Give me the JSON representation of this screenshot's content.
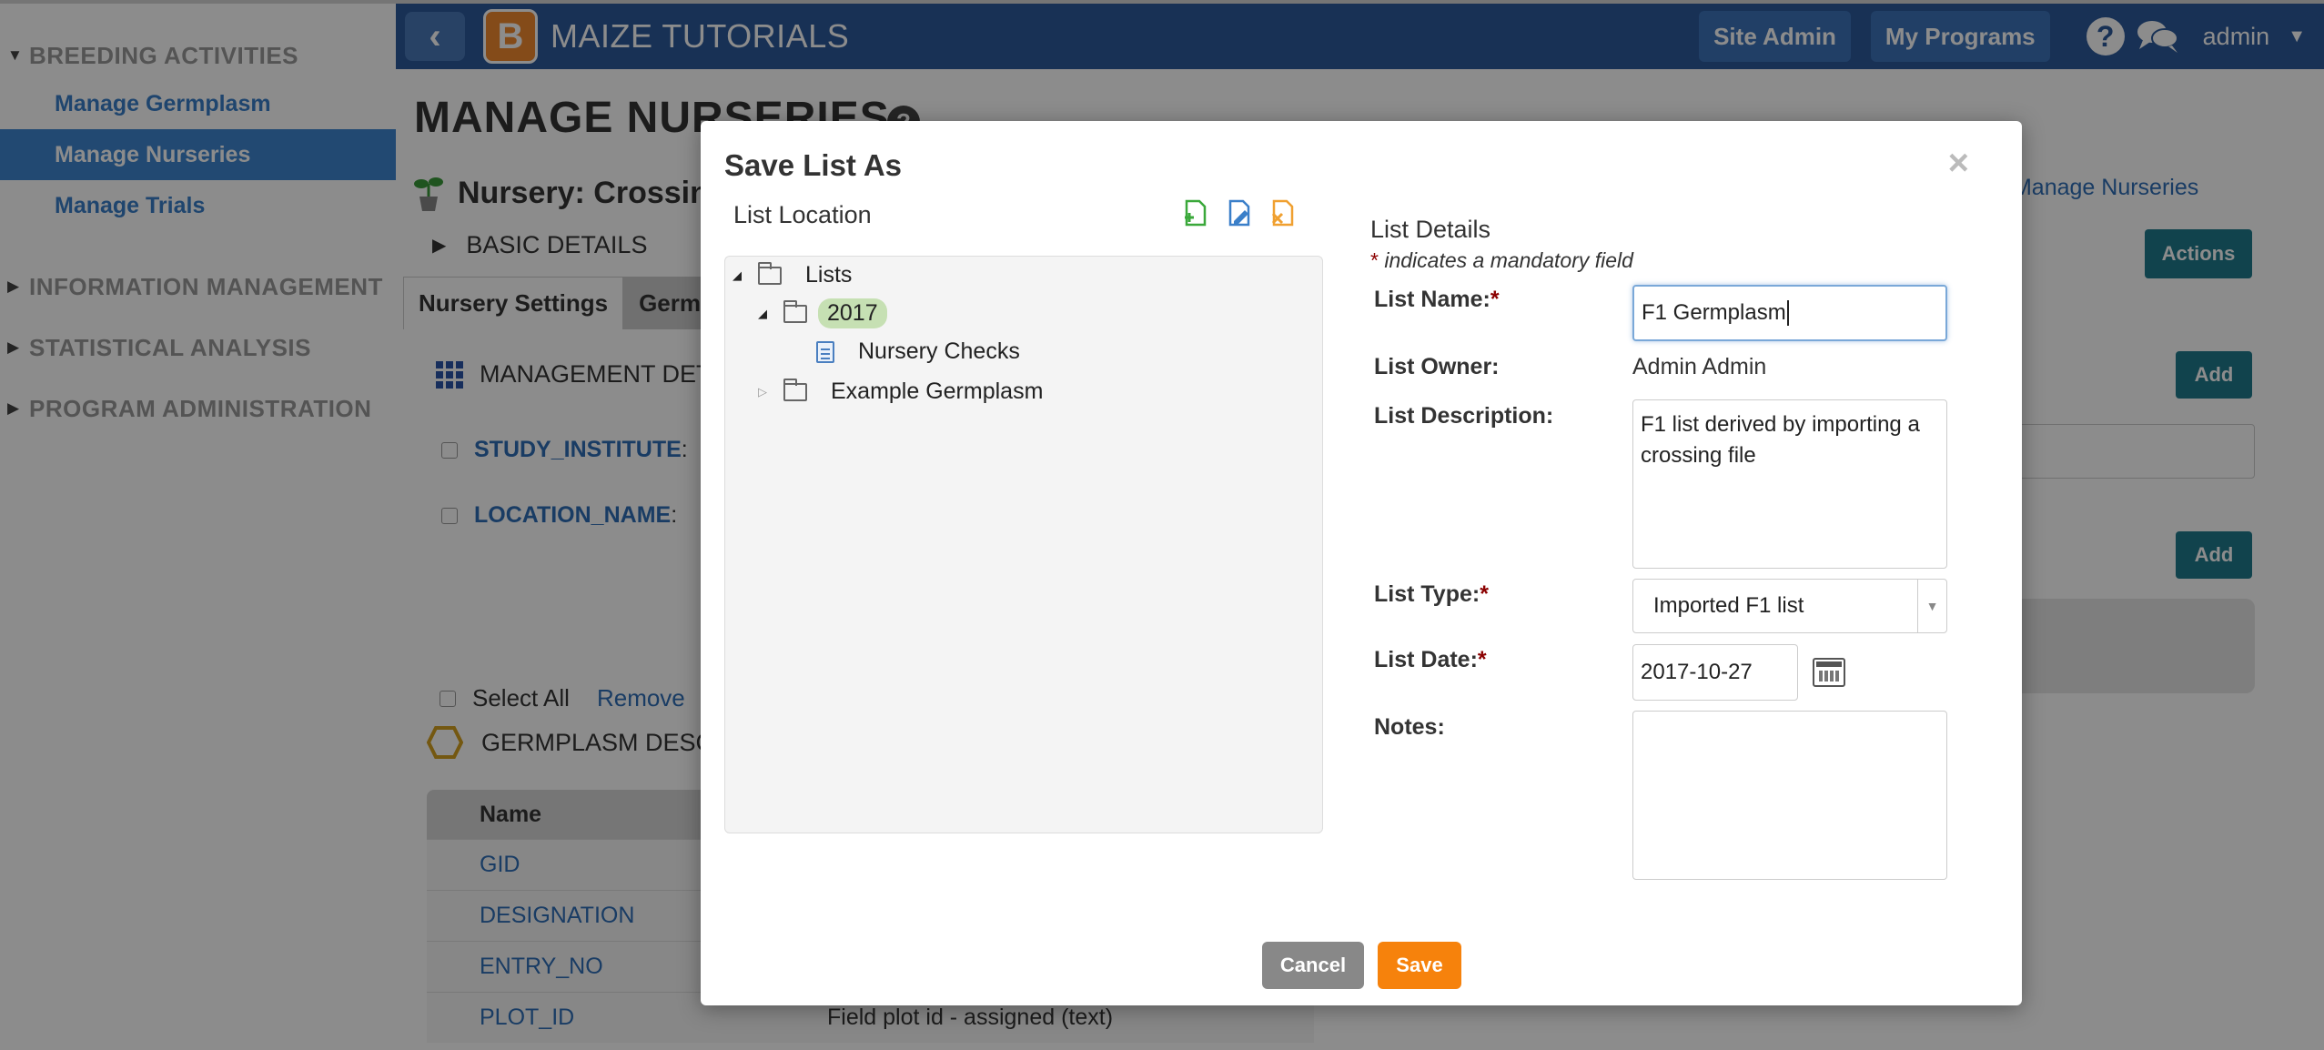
{
  "sidebar": {
    "groups": [
      {
        "label": "BREEDING ACTIVITIES",
        "expanded": true
      },
      {
        "label": "INFORMATION MANAGEMENT",
        "expanded": false
      },
      {
        "label": "STATISTICAL ANALYSIS",
        "expanded": false
      },
      {
        "label": "PROGRAM ADMINISTRATION",
        "expanded": false
      }
    ],
    "items": [
      {
        "label": "Manage Germplasm",
        "active": false
      },
      {
        "label": "Manage Nurseries",
        "active": true
      },
      {
        "label": "Manage Trials",
        "active": false
      }
    ]
  },
  "topbar": {
    "back_icon": "chevron-left-icon",
    "logo_letter": "B",
    "app_title": "MAIZE TUTORIALS",
    "site_admin": "Site Admin",
    "my_programs": "My Programs",
    "help_glyph": "?",
    "user": "admin",
    "colors": {
      "bar": "#2c5a9b",
      "logo": "#f0892e"
    }
  },
  "page": {
    "title": "MANAGE NURSERIES",
    "title_help": "?",
    "nursery_label": "Nursery: Crossin",
    "basic_details": "BASIC DETAILS",
    "tabs": [
      "Nursery Settings",
      "Germp"
    ],
    "management": "MANAGEMENT DETA",
    "fields": [
      "STUDY_INSTITUTE",
      "LOCATION_NAME"
    ],
    "field_colon": ":",
    "select_all": "Select All",
    "remove": "Remove",
    "germplasm_header": "GERMPLASM DESCR",
    "table_header": "Name",
    "table_rows": [
      {
        "name": "GID",
        "desc": ""
      },
      {
        "name": "DESIGNATION",
        "desc": ""
      },
      {
        "name": "ENTRY_NO",
        "desc": ""
      },
      {
        "name": "PLOT_ID",
        "desc": "Field plot id - assigned (text)"
      }
    ],
    "back_link": "rn to Manage Nurseries",
    "actions_btn": "Actions",
    "add_btn_1": "Add",
    "add_btn_2": "Add"
  },
  "modal": {
    "title": "Save List As",
    "close_glyph": "×",
    "location_label": "List Location",
    "tree": {
      "root": "Lists",
      "folder_2017": "2017",
      "nursery_checks": "Nursery Checks",
      "example_germplasm": "Example Germplasm"
    },
    "details_title": "List Details",
    "mandatory_star": "*",
    "mandatory_note": " indicates a mandatory field",
    "labels": {
      "name": "List Name:",
      "owner": "List Owner:",
      "description": "List Description:",
      "type": "List Type:",
      "date": "List Date:",
      "notes": "Notes:"
    },
    "required_star": "*",
    "values": {
      "name": "F1 Germplasm",
      "owner": "Admin Admin",
      "description": "F1 list derived by importing a crossing file",
      "type": "Imported F1 list",
      "date": "2017-10-27",
      "notes": ""
    },
    "cancel": "Cancel",
    "save": "Save",
    "colors": {
      "cancel": "#888888",
      "save": "#f6820c",
      "selected_folder": "#c6e0b3"
    }
  }
}
